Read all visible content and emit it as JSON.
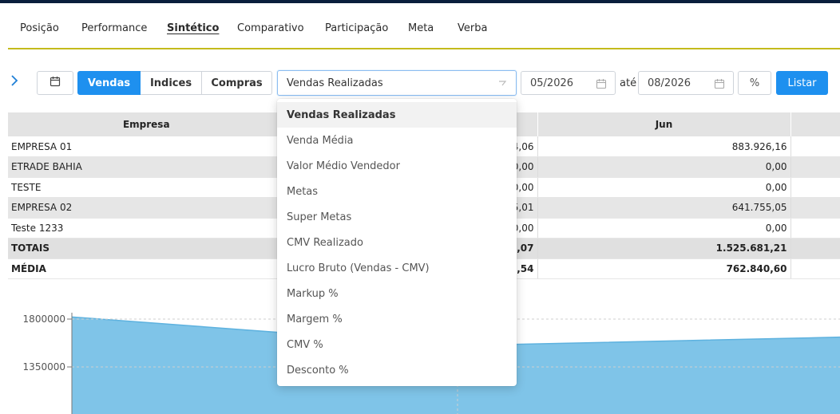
{
  "nav": {
    "items": [
      "Posição",
      "Performance",
      "Sintético",
      "Comparativo",
      "Participação",
      "Meta",
      "Verba"
    ],
    "active": "Sintético"
  },
  "toolbar": {
    "segments": [
      "Vendas",
      "Indices",
      "Compras"
    ],
    "active_segment": "Vendas",
    "metric_select": "Vendas Realizadas",
    "date_from": "05/2026",
    "date_separator": "até",
    "date_to": "08/2026",
    "percent_label": "%",
    "list_label": "Listar"
  },
  "dropdown": {
    "options": [
      "Vendas Realizadas",
      "Venda Média",
      "Valor Médio Vendedor",
      "Metas",
      "Super Metas",
      "CMV Realizado",
      "Lucro Bruto (Vendas - CMV)",
      "Markup %",
      "Margem %",
      "CMV %",
      "Desconto %"
    ],
    "selected": "Vendas Realizadas"
  },
  "table": {
    "headers": [
      "Empresa",
      "",
      "Jun",
      ""
    ],
    "rows": [
      {
        "empresa": "EMPRESA 01",
        "mai": "4,06",
        "jun": "883.926,16"
      },
      {
        "empresa": "ETRADE BAHIA",
        "mai": "0,00",
        "jun": "0,00"
      },
      {
        "empresa": "TESTE",
        "mai": "0,00",
        "jun": "0,00"
      },
      {
        "empresa": "EMPRESA 02",
        "mai": "5,01",
        "jun": "641.755,05"
      },
      {
        "empresa": "Teste 1233",
        "mai": "0,00",
        "jun": "0,00"
      }
    ],
    "totals": {
      "empresa": "TOTAIS",
      "mai": "9,07",
      "jun": "1.525.681,21"
    },
    "average": {
      "empresa": "MÉDIA",
      "mai": "4,54",
      "jun": "762.840,60"
    }
  },
  "chart_data": {
    "type": "area",
    "x": [
      0,
      1,
      2
    ],
    "values": [
      1820000,
      1550000,
      1630000
    ],
    "yticks": [
      1800000,
      1350000
    ],
    "ylim": [
      1000000,
      1900000
    ],
    "grid": true,
    "color": "#7fc4e8"
  },
  "colors": {
    "accent": "#1e90ef",
    "nav_underline": "#c4bb1c",
    "top_bar": "#0a1e3c"
  },
  "icons": {
    "expand": "chevron-right-icon",
    "calendar": "calendar-icon",
    "select": "chevron-down-icon"
  }
}
